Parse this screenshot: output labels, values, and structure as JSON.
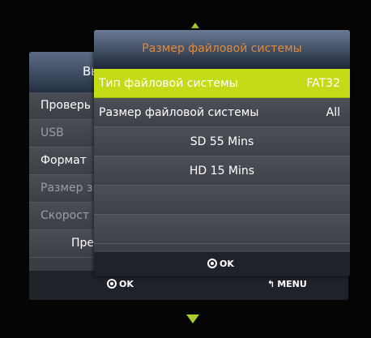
{
  "back_menu": {
    "title": "Вы",
    "items": [
      {
        "label": "Проверь"
      },
      {
        "label": "USB"
      },
      {
        "label": "Формат"
      },
      {
        "label": "Размер з"
      },
      {
        "label": "Скорост"
      },
      {
        "label": "Пре"
      }
    ],
    "footer_ok": "OK",
    "footer_menu": "MENU"
  },
  "dialog": {
    "title": "Размер файловой системы",
    "rows": [
      {
        "label": "Тип файловой системы",
        "value": "FAT32",
        "selected": true
      },
      {
        "label": "Размер файловой системы",
        "value": "All"
      },
      {
        "label": "SD 55 Mins"
      },
      {
        "label": "HD 15 Mins"
      }
    ],
    "footer_ok": "OK"
  },
  "colors": {
    "accent": "#c4dc18",
    "title": "#e08a3c",
    "arrow": "#a8cf2a"
  }
}
